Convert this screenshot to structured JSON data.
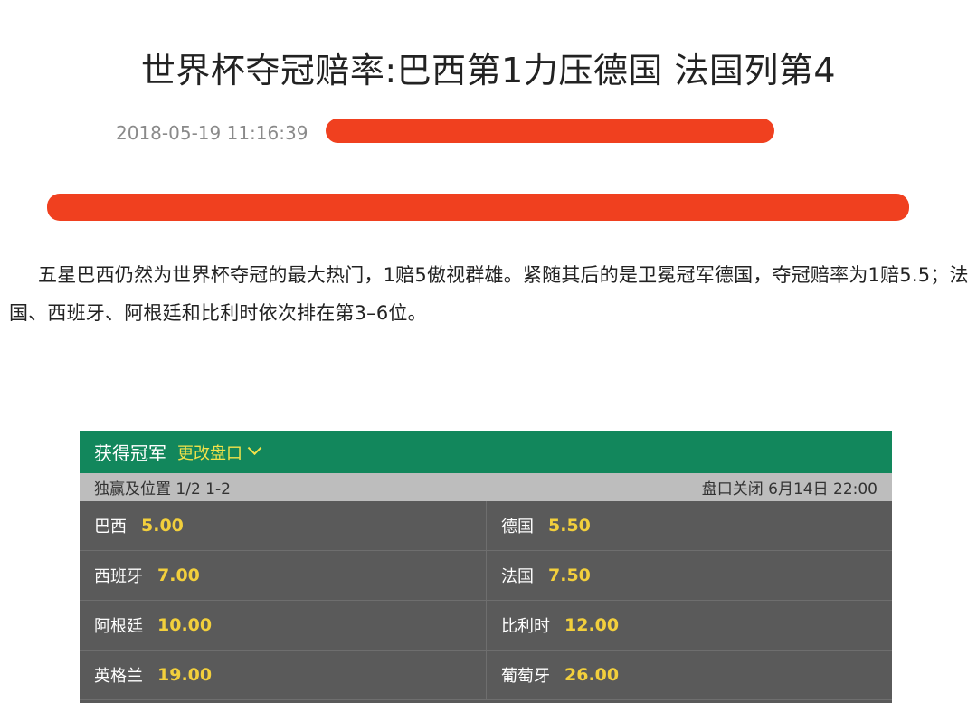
{
  "article": {
    "title": "世界杯夺冠赔率:巴西第1力压德国 法国列第4",
    "date": "2018-05-19 11:16:39",
    "paragraph": "五星巴西仍然为世界杯夺冠的最大热门，1赔5傲视群雄。紧随其后的是卫冕冠军德国，夺冠赔率为1赔5.5；法国、西班牙、阿根廷和比利时依次排在第3–6位。"
  },
  "widget": {
    "market": "获得冠军",
    "change_market": "更改盘口",
    "subtitle": "独赢及位置 1/2 1-2",
    "closing": "盘口关闭 6月14日 22:00",
    "rows": [
      {
        "left": {
          "team": "巴西",
          "odds": "5.00"
        },
        "right": {
          "team": "德国",
          "odds": "5.50"
        }
      },
      {
        "left": {
          "team": "西班牙",
          "odds": "7.00"
        },
        "right": {
          "team": "法国",
          "odds": "7.50"
        }
      },
      {
        "left": {
          "team": "阿根廷",
          "odds": "10.00"
        },
        "right": {
          "team": "比利时",
          "odds": "12.00"
        }
      },
      {
        "left": {
          "team": "英格兰",
          "odds": "19.00"
        },
        "right": {
          "team": "葡萄牙",
          "odds": "26.00"
        }
      }
    ]
  },
  "colors": {
    "header_green": "#12875c",
    "odds_yellow": "#f2cf3c",
    "change_yellow": "#f2e24a",
    "redaction_red": "#f0401f"
  }
}
